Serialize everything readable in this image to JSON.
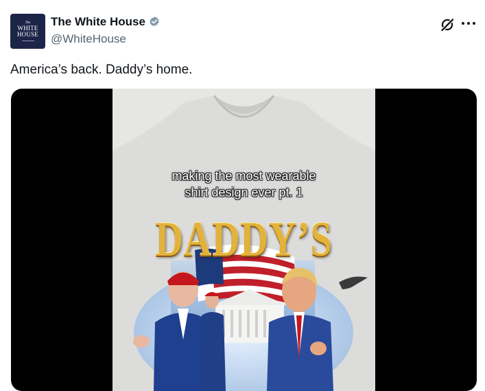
{
  "author": {
    "avatar_lines": [
      "The",
      "WHITE",
      "HOUSE"
    ],
    "display_name": "The White House",
    "handle": "@WhiteHouse",
    "verified_icon": "verified-badge-icon"
  },
  "header_actions": {
    "grok_icon": "grok-slash-icon",
    "more_icon": "more-dots-icon"
  },
  "tweet": {
    "text": "America’s back. Daddy’s home."
  },
  "media": {
    "caption_line1": "making the most wearable",
    "caption_line2": "shirt design ever pt. 1",
    "shirt_title": "DADDY’S"
  },
  "colors": {
    "avatar_bg": "#1c2547",
    "verified": "#829aab",
    "text_primary": "#0f1419",
    "text_secondary": "#536471",
    "shirt_gold": "#e3b23c"
  }
}
